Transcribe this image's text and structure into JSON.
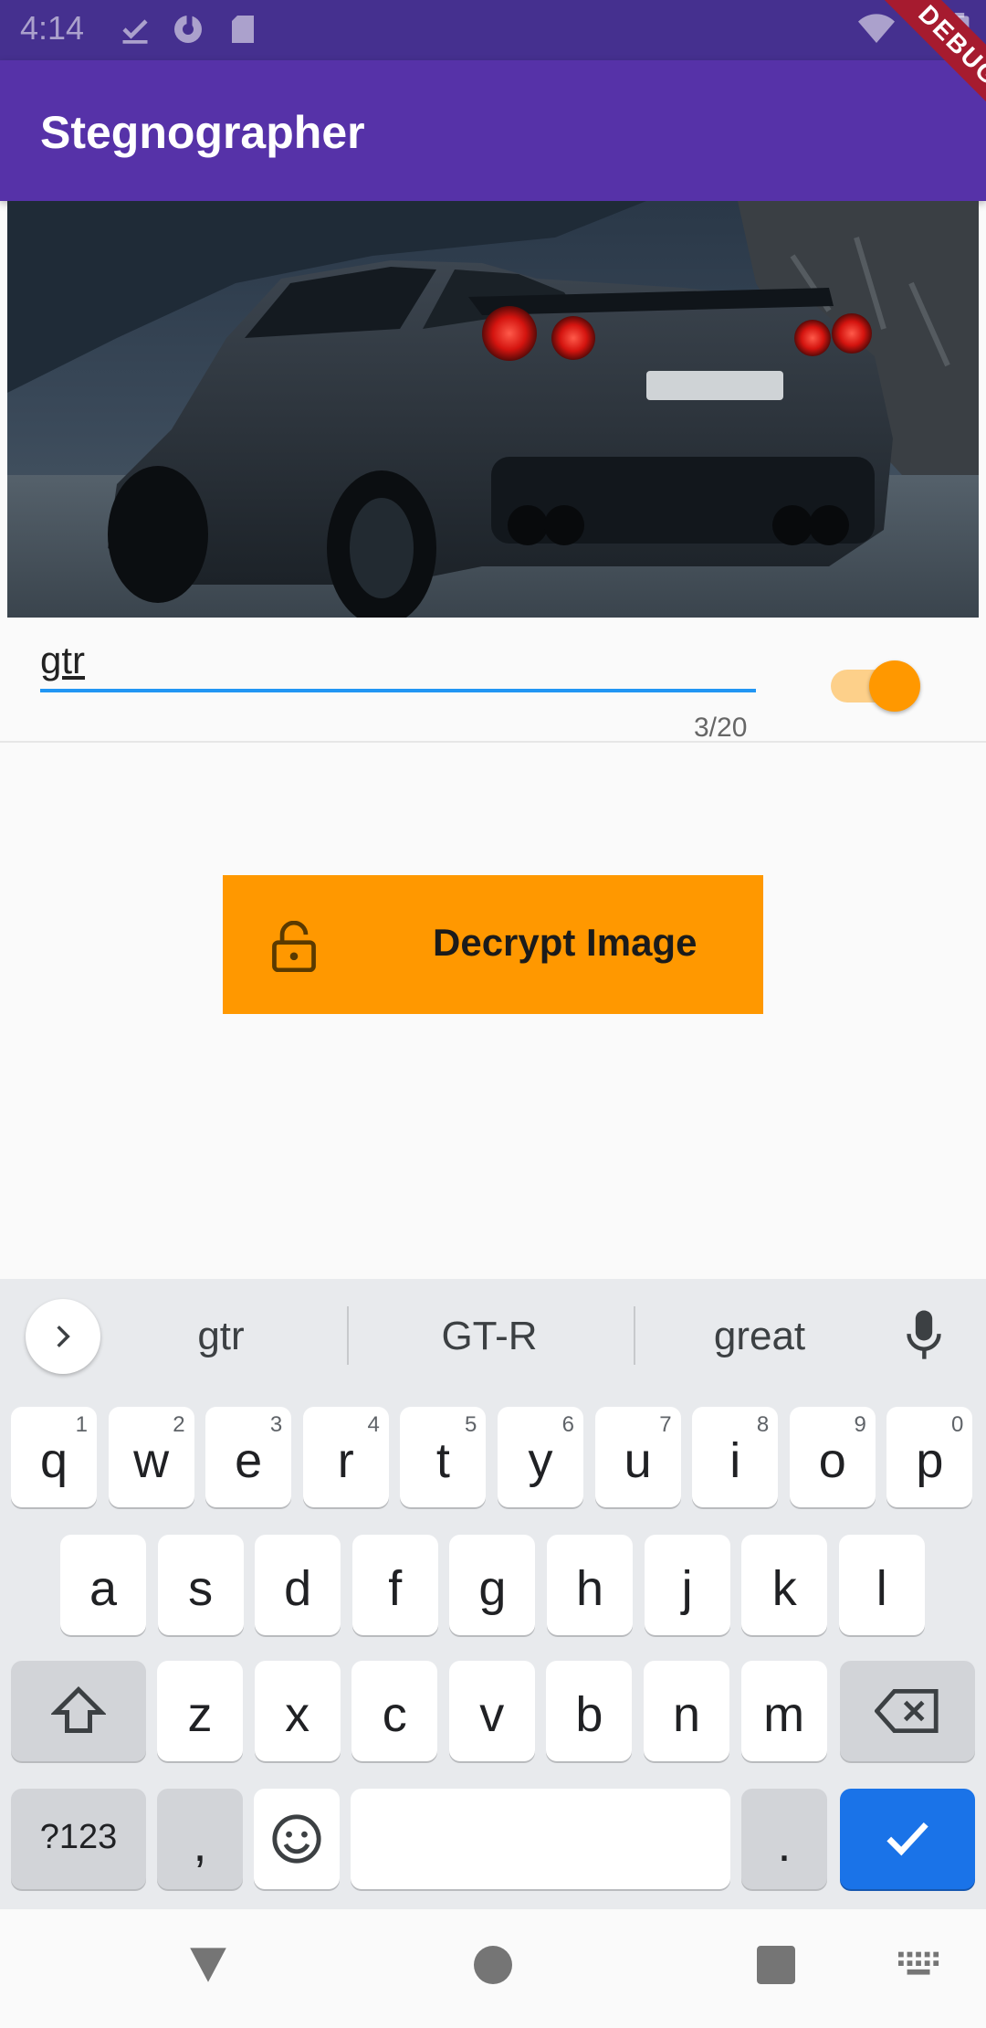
{
  "status_bar": {
    "time": "4:14"
  },
  "app_bar": {
    "title": "Stegnographer",
    "debug_banner": "DEBUG"
  },
  "form": {
    "secret_value": "gtr",
    "char_counter": "3/20",
    "toggle_on": true
  },
  "decrypt_button": {
    "label": "Decrypt Image"
  },
  "keyboard": {
    "suggestions": [
      "gtr",
      "GT-R",
      "great"
    ],
    "row1": [
      {
        "k": "q",
        "n": "1"
      },
      {
        "k": "w",
        "n": "2"
      },
      {
        "k": "e",
        "n": "3"
      },
      {
        "k": "r",
        "n": "4"
      },
      {
        "k": "t",
        "n": "5"
      },
      {
        "k": "y",
        "n": "6"
      },
      {
        "k": "u",
        "n": "7"
      },
      {
        "k": "i",
        "n": "8"
      },
      {
        "k": "o",
        "n": "9"
      },
      {
        "k": "p",
        "n": "0"
      }
    ],
    "row2": [
      "a",
      "s",
      "d",
      "f",
      "g",
      "h",
      "j",
      "k",
      "l"
    ],
    "row3": [
      "z",
      "x",
      "c",
      "v",
      "b",
      "n",
      "m"
    ],
    "symbols_key": "?123",
    "comma_key": ",",
    "period_key": "."
  },
  "colors": {
    "app_bar": "#5632a8",
    "status_bar": "#45308f",
    "accent": "#ff9800",
    "input_underline": "#2196f3",
    "enter_key": "#1a73e8"
  },
  "icons": [
    "check-icon",
    "data-saver-icon",
    "sd-card-icon",
    "wifi-icon",
    "battery-icon",
    "lock-open-icon",
    "chevron-right-icon",
    "mic-icon",
    "shift-icon",
    "backspace-icon",
    "emoji-icon",
    "check-enter-icon",
    "nav-back-icon",
    "nav-home-icon",
    "nav-recents-icon",
    "keyboard-icon"
  ]
}
